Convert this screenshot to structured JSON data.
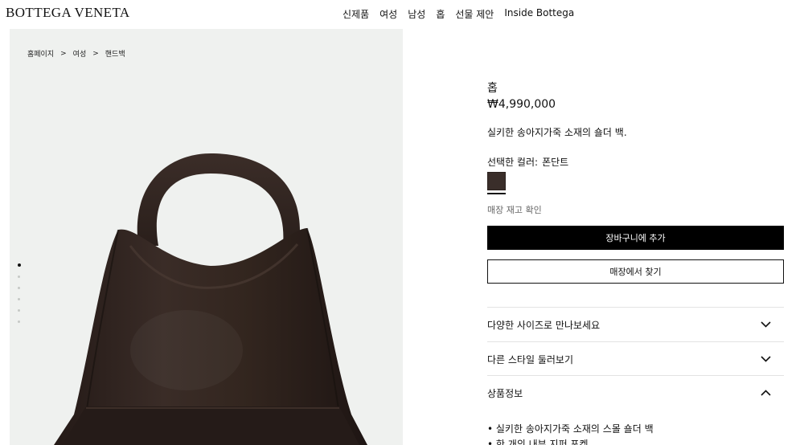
{
  "header": {
    "logo": "BOTTEGA VENETA",
    "nav": [
      "신제품",
      "여성",
      "남성",
      "홉",
      "선물 제안",
      "Inside Bottega"
    ]
  },
  "breadcrumb": {
    "items": [
      "홈페이지",
      "여성",
      "핸드백"
    ],
    "separator": ">"
  },
  "gallery": {
    "dot_count": 6,
    "active_dot": 0
  },
  "product": {
    "name": "홉",
    "price": "₩4,990,000",
    "description": "실키한 송아지가죽 소재의 숄더 백.",
    "color_label": "선택한 컬러:",
    "color_value": "폰단트",
    "color_hex": "#3a2e2a",
    "stock_link": "매장 재고 확인",
    "add_to_cart": "장바구니에 추가",
    "find_in_store": "매장에서 찾기"
  },
  "accordions": [
    {
      "label": "다양한 사이즈로 만나보세요",
      "state": "collapsed"
    },
    {
      "label": "다른 스타일 둘러보기",
      "state": "collapsed"
    },
    {
      "label": "상품정보",
      "state": "expanded"
    }
  ],
  "details": [
    "• 실키한 송아지가죽 소재의 스몰 숄더 백",
    "• 한 개의 내부 지퍼 포켓"
  ]
}
